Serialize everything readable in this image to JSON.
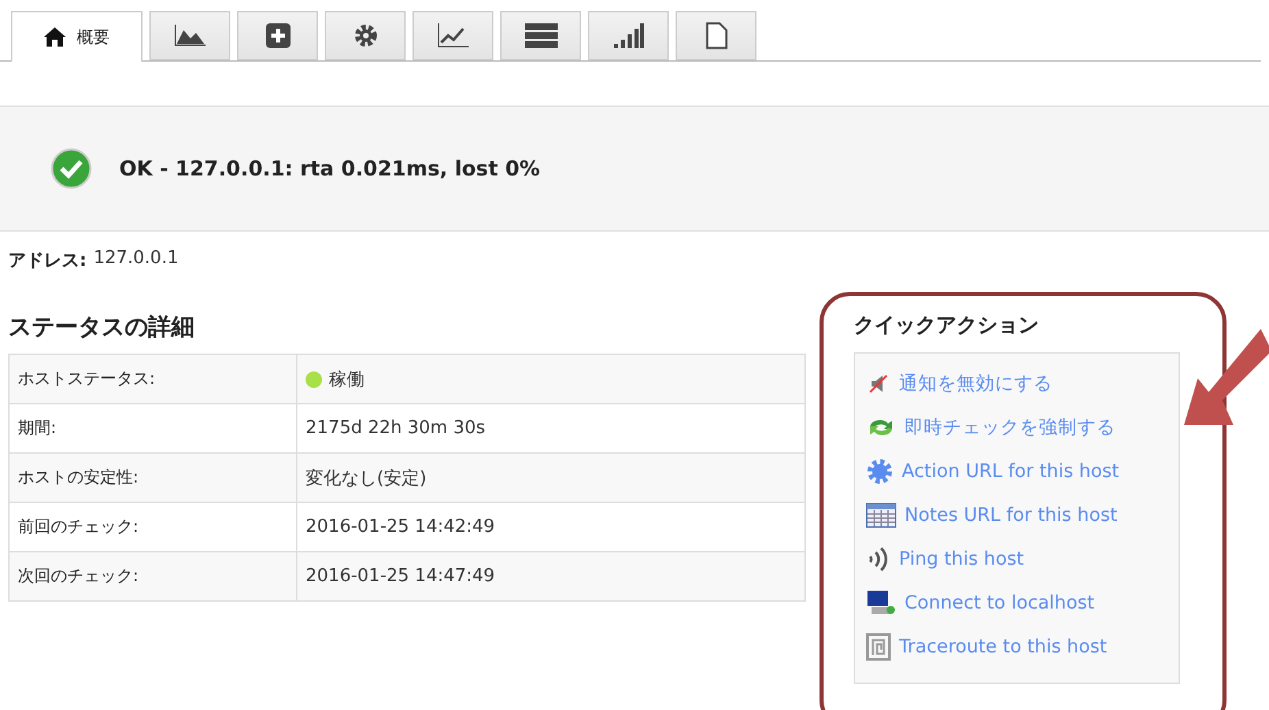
{
  "tabs": [
    {
      "kind": "home",
      "label": "概要",
      "selected": true
    },
    {
      "kind": "area",
      "selected": false
    },
    {
      "kind": "plus",
      "selected": false
    },
    {
      "kind": "gear",
      "selected": false
    },
    {
      "kind": "trend",
      "selected": false
    },
    {
      "kind": "list",
      "selected": false
    },
    {
      "kind": "bars",
      "selected": false
    },
    {
      "kind": "page",
      "selected": false
    }
  ],
  "status": {
    "message": "OK - 127.0.0.1: rta 0.021ms, lost 0%"
  },
  "address": {
    "label": "アドレス:",
    "value": "127.0.0.1"
  },
  "details": {
    "title": "ステータスの詳細",
    "rows": [
      {
        "label": "ホストステータス:",
        "value": "稼働",
        "color": "#a8e04a"
      },
      {
        "label": "期間:",
        "value": "2175d 22h 30m 30s"
      },
      {
        "label": "ホストの安定性:",
        "value": "変化なし(安定)"
      },
      {
        "label": "前回のチェック:",
        "value": "2016-01-25 14:42:49"
      },
      {
        "label": "次回のチェック:",
        "value": "2016-01-25 14:47:49"
      }
    ]
  },
  "quick_actions": {
    "title": "クイックアクション",
    "items": [
      {
        "kind": "mute",
        "label": "通知を無効にする"
      },
      {
        "kind": "refresh",
        "label": "即時チェックを強制する"
      },
      {
        "kind": "gear",
        "label": "Action URL for this host"
      },
      {
        "kind": "notes",
        "label": "Notes URL for this host"
      },
      {
        "kind": "ping",
        "label": "Ping this host"
      },
      {
        "kind": "computer",
        "label": "Connect to localhost"
      },
      {
        "kind": "trace",
        "label": "Traceroute to this host"
      }
    ]
  }
}
